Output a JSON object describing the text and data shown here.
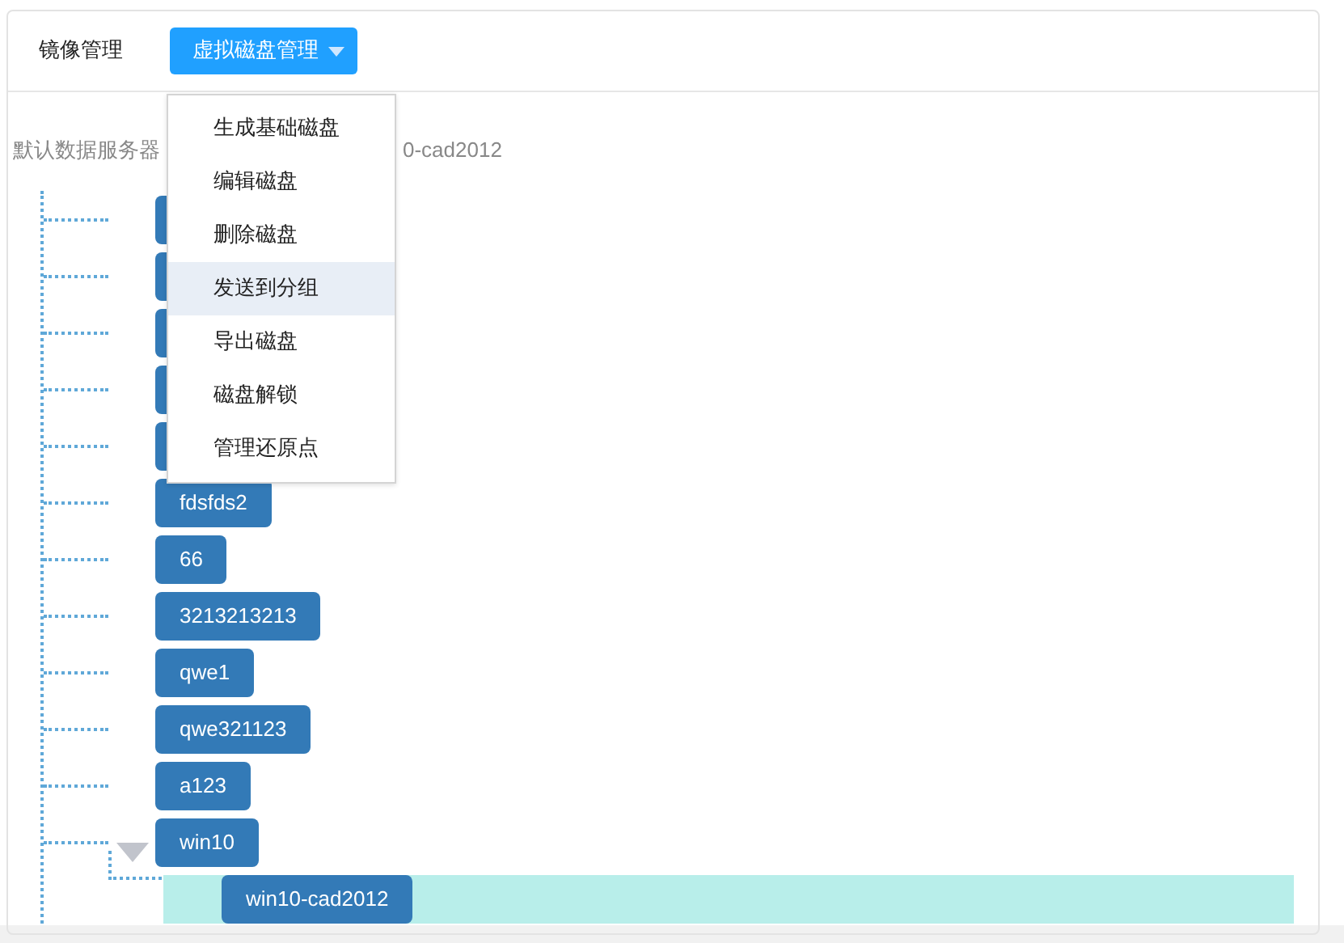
{
  "header": {
    "title": "镜像管理",
    "dropdown": {
      "label": "虚拟磁盘管理",
      "expanded": true
    }
  },
  "menu": [
    {
      "label": "生成基础磁盘",
      "selected": false
    },
    {
      "label": "编辑磁盘",
      "selected": false
    },
    {
      "label": "删除磁盘",
      "selected": false
    },
    {
      "label": "发送到分组",
      "selected": true
    },
    {
      "label": "导出磁盘",
      "selected": false
    },
    {
      "label": "磁盘解锁",
      "selected": false
    },
    {
      "label": "管理还原点",
      "selected": false
    }
  ],
  "info": {
    "left": "默认数据服务器",
    "right": "0-cad2012"
  },
  "tree": [
    {
      "kind": "covered"
    },
    {
      "kind": "covered"
    },
    {
      "kind": "covered"
    },
    {
      "kind": "covered"
    },
    {
      "kind": "covered"
    },
    {
      "kind": "leaf",
      "label": "fdsfds2"
    },
    {
      "kind": "leaf",
      "label": "66"
    },
    {
      "kind": "leaf",
      "label": "3213213213"
    },
    {
      "kind": "leaf",
      "label": "qwe1"
    },
    {
      "kind": "leaf",
      "label": "qwe321123"
    },
    {
      "kind": "leaf",
      "label": "a123"
    },
    {
      "kind": "folder",
      "label": "win10",
      "expanded": true,
      "children": [
        {
          "kind": "leaf",
          "label": "win10-cad2012",
          "selected": true
        }
      ]
    }
  ]
}
